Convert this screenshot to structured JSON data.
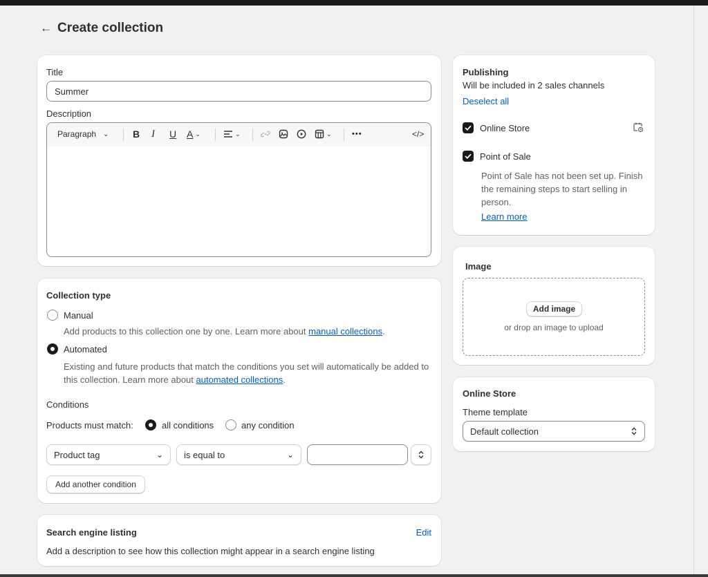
{
  "page": {
    "title": "Create collection"
  },
  "title_field": {
    "label": "Title",
    "value": "Summer"
  },
  "description": {
    "label": "Description",
    "format_select": "Paragraph",
    "toolbar": {
      "bold": "B",
      "italic": "I",
      "underline": "U",
      "text_color": "A",
      "more": "•••",
      "code": "</>"
    }
  },
  "collection_type": {
    "heading": "Collection type",
    "manual": {
      "label": "Manual",
      "help_text": "Add products to this collection one by one. Learn more about ",
      "help_link": "manual collections",
      "help_end": "."
    },
    "automated": {
      "label": "Automated",
      "help_text": "Existing and future products that match the conditions you set will automatically be added to this collection. Learn more about ",
      "help_link": "automated collections",
      "help_end": "."
    },
    "selected": "Automated"
  },
  "conditions": {
    "heading": "Conditions",
    "match_label": "Products must match:",
    "all_label": "all conditions",
    "any_label": "any condition",
    "match_selected": "all conditions",
    "rule": {
      "field": "Product tag",
      "relation": "is equal to",
      "value": ""
    },
    "add_button": "Add another condition"
  },
  "seo": {
    "heading": "Search engine listing",
    "edit": "Edit",
    "text": "Add a description to see how this collection might appear in a search engine listing"
  },
  "publishing": {
    "heading": "Publishing",
    "subtitle": "Will be included in 2 sales channels",
    "deselect": "Deselect all",
    "channels": [
      {
        "name": "Online Store",
        "checked": true
      },
      {
        "name": "Point of Sale",
        "checked": true,
        "note": "Point of Sale has not been set up. Finish the remaining steps to start selling in person.",
        "link": "Learn more"
      }
    ]
  },
  "image": {
    "heading": "Image",
    "add_button": "Add image",
    "drop_text": "or drop an image to upload"
  },
  "online_store": {
    "heading": "Online Store",
    "template_label": "Theme template",
    "template_value": "Default collection"
  },
  "colors": {
    "link": "#005bd3",
    "page_bg": "#f1f1f1",
    "dark": "#1a1a1a"
  }
}
